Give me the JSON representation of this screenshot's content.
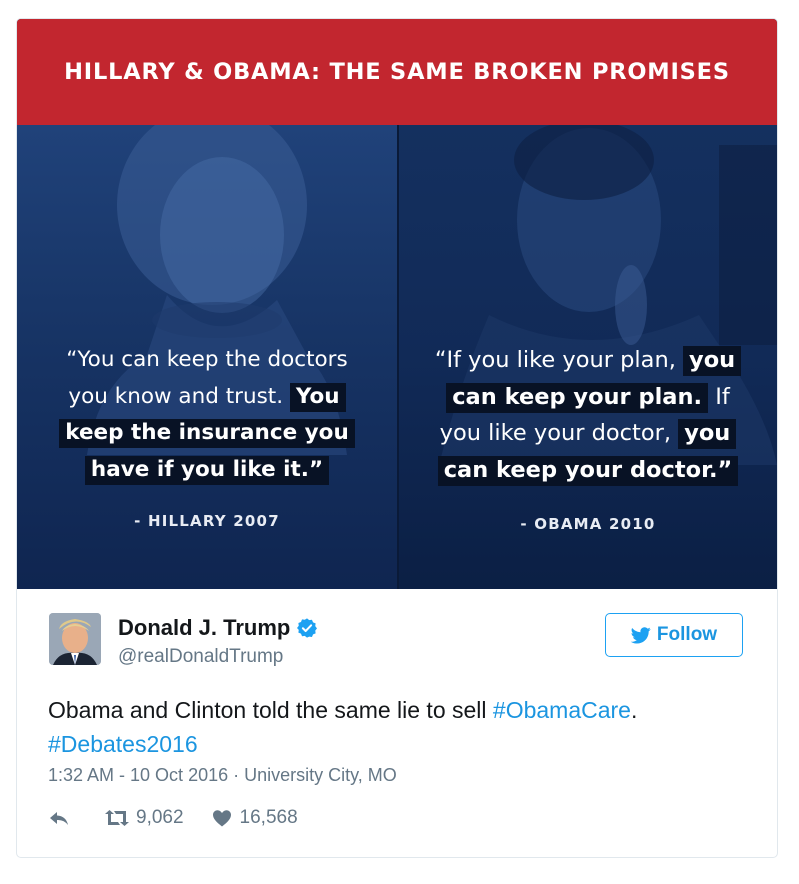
{
  "graphic": {
    "banner_title": "HILLARY & OBAMA: THE SAME BROKEN PROMISES",
    "left": {
      "quote_lines": [
        "“You can keep the doctors",
        "you know and trust.",
        "You",
        "keep the insurance you",
        "have if you like it.”"
      ],
      "attribution": "- HILLARY 2007"
    },
    "right": {
      "quote_lines": [
        "“If you like your plan,",
        "you",
        "can keep your plan.",
        "If",
        "you like your doctor,",
        "you",
        "can keep your doctor.”"
      ],
      "attribution": "- OBAMA 2010"
    },
    "colors": {
      "banner": "#c2262f",
      "panel": "#132a53"
    }
  },
  "tweet": {
    "author_name": "Donald J. Trump",
    "handle": "@realDonaldTrump",
    "verified_icon": "verified-badge-icon",
    "follow_label": "Follow",
    "text_before": "Obama and Clinton told the same lie to sell ",
    "hashtag_1": "#ObamaCare",
    "text_after": ".",
    "hashtag_2": "#Debates2016",
    "timestamp": "1:32 AM - 10 Oct 2016",
    "separator": " · ",
    "location": "University City, MO",
    "retweet_count": "9,062",
    "like_count": "16,568",
    "accent_color": "#1da1f2"
  }
}
